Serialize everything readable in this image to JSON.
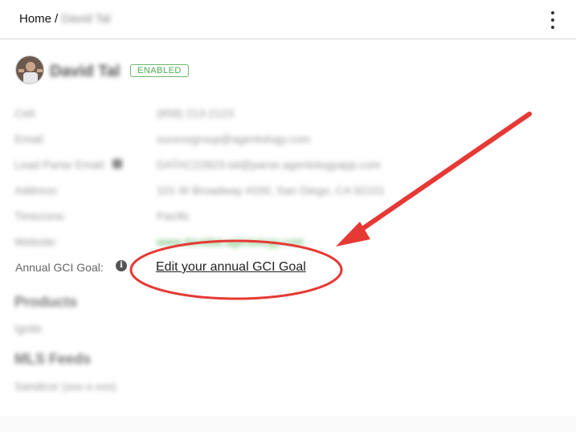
{
  "breadcrumb": {
    "home": "Home",
    "separator": "/",
    "current": "David Tal"
  },
  "profile": {
    "name": "David Tal",
    "status": "ENABLED"
  },
  "details": [
    {
      "label": "Cell:",
      "value": "(858) 213-2123"
    },
    {
      "label": "Email:",
      "value": "sucessgroup@agentology.com"
    },
    {
      "label": "Lead Parse Email:",
      "value": "DATAC22823-tal@parse.agentologyapp.com"
    },
    {
      "label": "Address:",
      "value": "101 W Broadway #200, San Diego, CA 92101"
    },
    {
      "label": "Timezone:",
      "value": "Pacific"
    },
    {
      "label": "Website:",
      "value": "www.davidtal.agentology.com"
    }
  ],
  "goal": {
    "label": "Annual GCI Goal:",
    "link_text": "Edit your annual GCI Goal"
  },
  "products": {
    "heading": "Products",
    "item": "Ignite"
  },
  "mls": {
    "heading": "MLS Feeds",
    "item": "Sandicor (xxx-x-xxx)"
  },
  "colors": {
    "enabled": "#4caf50",
    "annotation": "#e53935"
  },
  "icons": {
    "menu": "kebab-menu-icon",
    "info": "info-icon",
    "copy": "copy-icon"
  }
}
